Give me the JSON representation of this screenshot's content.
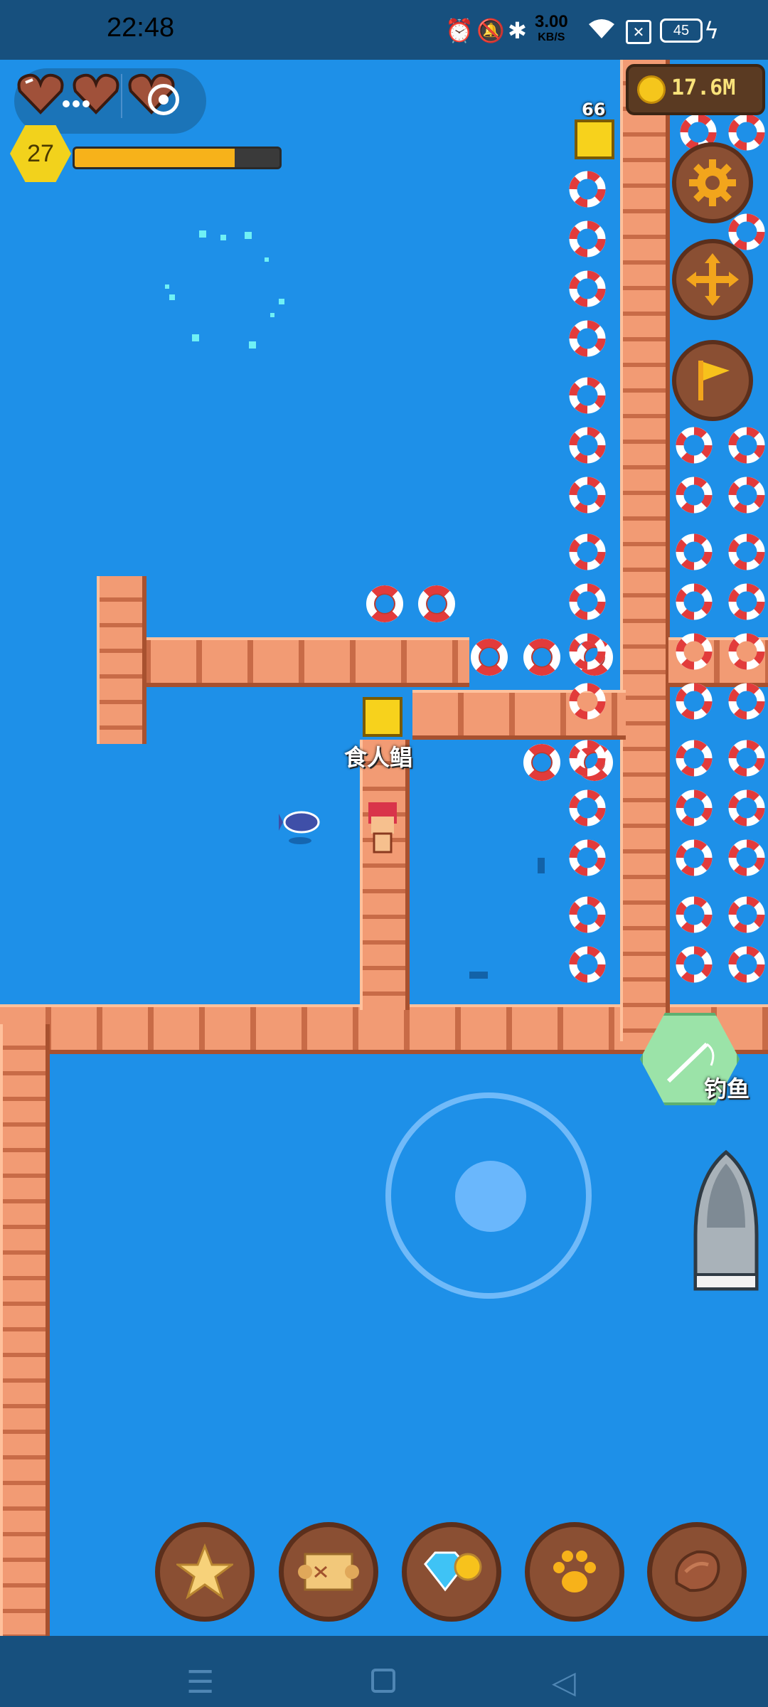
{
  "status_bar": {
    "time": "22:48",
    "net_speed_value": "3.00",
    "net_speed_unit": "KB/S",
    "battery": "45"
  },
  "player": {
    "level": "27",
    "xp_fraction": 0.78,
    "hearts": 3
  },
  "coins": {
    "value": "17.6M"
  },
  "map_labels": {
    "chest_count": "66",
    "npc_name": "食人鲳"
  },
  "actions": {
    "fishing_label": "钓鱼"
  },
  "toolbar": {
    "items": [
      "star-icon",
      "map-scroll-icon",
      "gems-coins-icon",
      "paw-icon",
      "meat-icon"
    ]
  },
  "colors": {
    "water": "#1E90E8",
    "dock": "#F29B74",
    "status_bar": "#17507E",
    "xp_fill": "#F7B21A",
    "level_badge": "#F2D21C"
  }
}
